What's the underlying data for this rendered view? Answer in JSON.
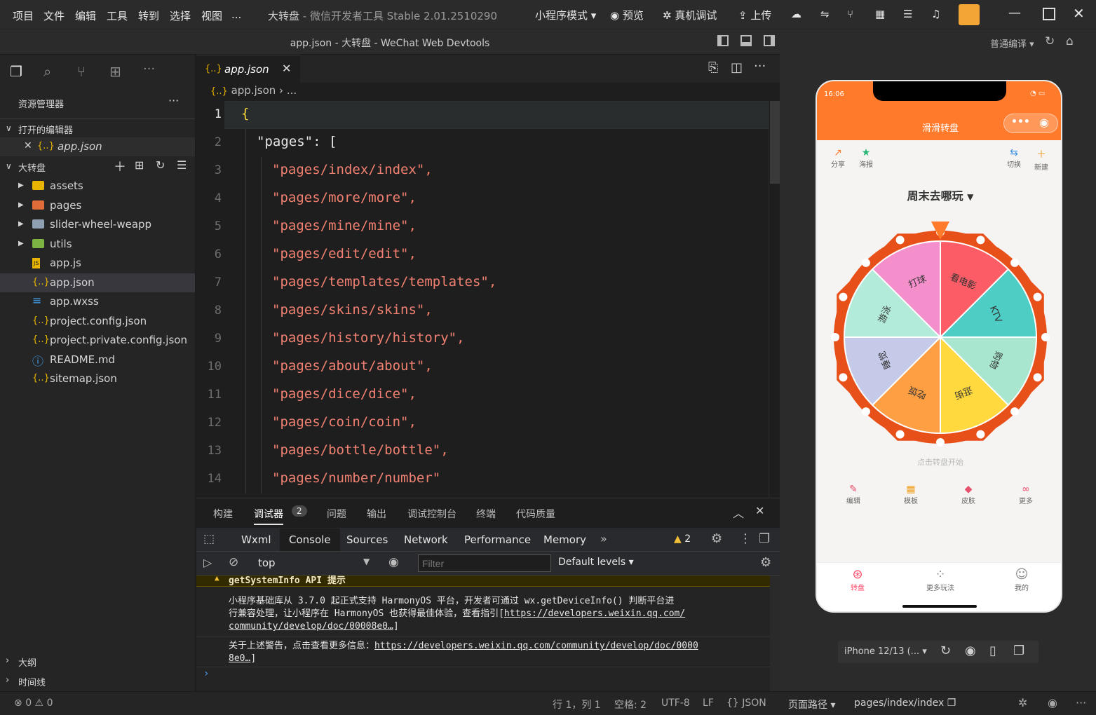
{
  "titlebar": {
    "menu": [
      "项目",
      "文件",
      "编辑",
      "工具",
      "转到",
      "选择",
      "视图",
      "..."
    ],
    "title": "大转盘",
    "subtitle_app": "- 微信开发者工具 Stable 2.01.2510290",
    "mode": "小程序模式",
    "preview": "预览",
    "realdebug": "真机调试",
    "upload": "上传"
  },
  "window_title": "app.json - 大转盘 - WeChat Web Devtools",
  "right_sub": {
    "compile": "普通编译"
  },
  "sidebar": {
    "header": "资源管理器",
    "open_editors": "打开的编辑器",
    "open_file": "app.json",
    "project": "大转盘",
    "items": [
      {
        "name": "assets",
        "type": "folder",
        "color": "#e8b400"
      },
      {
        "name": "pages",
        "type": "folder",
        "color": "#e06c3a"
      },
      {
        "name": "slider-wheel-weapp",
        "type": "folder",
        "color": "#8fa0b3"
      },
      {
        "name": "utils",
        "type": "folder",
        "color": "#7cb342"
      },
      {
        "name": "app.js",
        "type": "js"
      },
      {
        "name": "app.json",
        "type": "json"
      },
      {
        "name": "app.wxss",
        "type": "css"
      },
      {
        "name": "project.config.json",
        "type": "json"
      },
      {
        "name": "project.private.config.json",
        "type": "json"
      },
      {
        "name": "README.md",
        "type": "info"
      },
      {
        "name": "sitemap.json",
        "type": "json"
      }
    ],
    "outline": "大纲",
    "timeline": "时间线"
  },
  "editor": {
    "tab": "app.json",
    "crumb": "app.json",
    "crumb_more": "...",
    "lines": [
      {
        "n": "1",
        "text": "{",
        "kind": "brace"
      },
      {
        "n": "2",
        "text": "\"pages\": [",
        "kind": "key"
      },
      {
        "n": "3",
        "text": "\"pages/index/index\",",
        "kind": "str"
      },
      {
        "n": "4",
        "text": "\"pages/more/more\",",
        "kind": "str"
      },
      {
        "n": "5",
        "text": "\"pages/mine/mine\",",
        "kind": "str"
      },
      {
        "n": "6",
        "text": "\"pages/edit/edit\",",
        "kind": "str"
      },
      {
        "n": "7",
        "text": "\"pages/templates/templates\",",
        "kind": "str"
      },
      {
        "n": "8",
        "text": "\"pages/skins/skins\",",
        "kind": "str"
      },
      {
        "n": "9",
        "text": "\"pages/history/history\",",
        "kind": "str"
      },
      {
        "n": "10",
        "text": "\"pages/about/about\",",
        "kind": "str"
      },
      {
        "n": "11",
        "text": "\"pages/dice/dice\",",
        "kind": "str"
      },
      {
        "n": "12",
        "text": "\"pages/coin/coin\",",
        "kind": "str"
      },
      {
        "n": "13",
        "text": "\"pages/bottle/bottle\",",
        "kind": "str"
      },
      {
        "n": "14",
        "text": "\"pages/number/number\"",
        "kind": "str"
      }
    ]
  },
  "panel": {
    "tabs": [
      "构建",
      "调试器",
      "问题",
      "输出",
      "调试控制台",
      "终端",
      "代码质量"
    ],
    "debugger_badge": "2",
    "devtabs": [
      "Wxml",
      "Console",
      "Sources",
      "Network",
      "Performance",
      "Memory"
    ],
    "warn_count": "2",
    "context": "top",
    "filter_placeholder": "Filter",
    "levels": "Default levels",
    "console": {
      "warn_title": "getSystemInfo API 提示",
      "msg1_a": "小程序基础库从 3.7.0 起正式支持 HarmonyOS 平台，开发者可通过 wx.getDeviceInfo() 判断平台进",
      "msg1_b": "行兼容处理，让小程序在 HarmonyOS 也获得最佳体验，查看指引[",
      "msg1_link": "https://developers.weixin.qq.com/",
      "msg1_link2": "community/develop/doc/00008e0…",
      "msg1_end": "]",
      "msg2_a": "关于上述警告，点击查看更多信息：",
      "msg2_link": "https://developers.weixin.qq.com/community/develop/doc/0000",
      "msg2_link2": "8e0…",
      "msg2_end": "]"
    }
  },
  "status": {
    "errors": "0",
    "warnings": "0",
    "position": "行 1，列 1",
    "spaces": "空格: 2",
    "encoding": "UTF-8",
    "eol": "LF",
    "lang": "JSON",
    "page_path_label": "页面路径",
    "page_path": "pages/index/index"
  },
  "phone": {
    "time": "16:06",
    "title": "滑滑转盘",
    "top_actions": [
      "分享",
      "海报",
      "切换",
      "新建"
    ],
    "wheel_title": "周末去哪玩",
    "hint": "点击转盘开始",
    "segments": [
      {
        "label": "看电影",
        "color": "#fc5c65"
      },
      {
        "label": "KTV",
        "color": "#4ecdc4"
      },
      {
        "label": "购物",
        "color": "#a8e6cf"
      },
      {
        "label": "逛街",
        "color": "#ffd93d"
      },
      {
        "label": "吃饭",
        "color": "#ff9f43"
      },
      {
        "label": "睡觉",
        "color": "#c5cae9"
      },
      {
        "label": "游泳",
        "color": "#b2ebd9"
      },
      {
        "label": "打球",
        "color": "#f48fcb"
      }
    ],
    "bottom_actions": [
      "编辑",
      "模板",
      "皮肤",
      "更多"
    ],
    "nav": [
      "转盘",
      "更多玩法",
      "我的"
    ],
    "accent": "#ff7b2b",
    "rim": "#e8501a"
  },
  "device": {
    "model": "iPhone 12/13 (..."
  }
}
